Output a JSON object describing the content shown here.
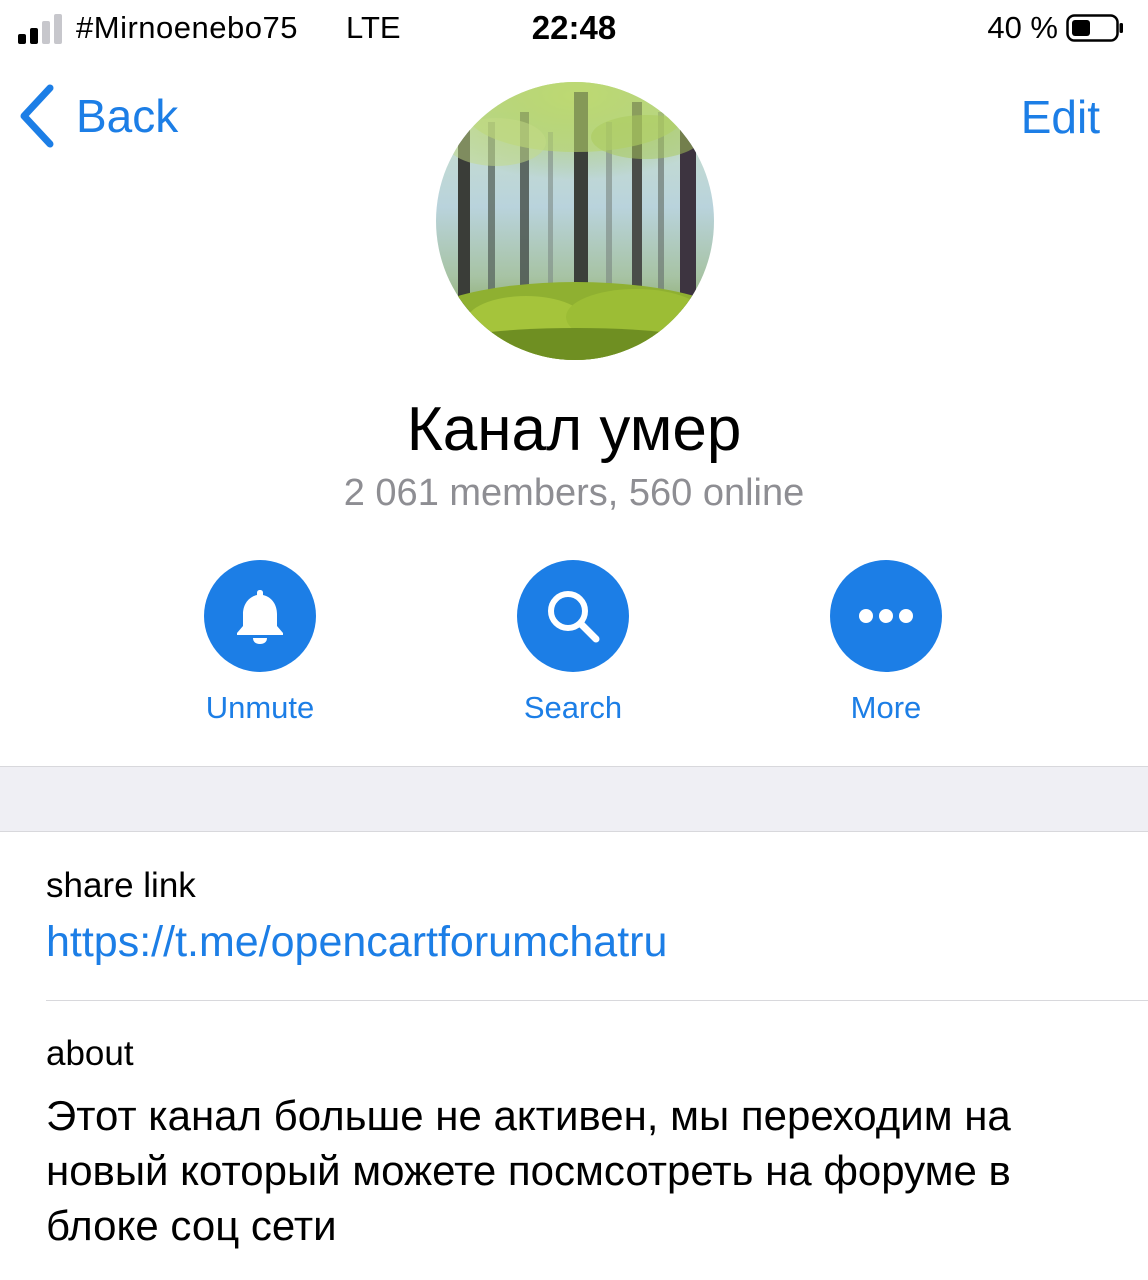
{
  "status_bar": {
    "carrier": "#Mirnoenebo75",
    "network": "LTE",
    "time": "22:48",
    "battery_percent": "40 %",
    "signal_bars_filled": 2,
    "signal_bars_total": 4,
    "battery_level": 0.4
  },
  "nav": {
    "back_label": "Back",
    "edit_label": "Edit"
  },
  "channel": {
    "title": "Канал умер",
    "subtitle": "2 061 members, 560 online"
  },
  "actions": [
    {
      "label": "Unmute",
      "icon": "bell-icon"
    },
    {
      "label": "Search",
      "icon": "search-icon"
    },
    {
      "label": "More",
      "icon": "more-icon"
    }
  ],
  "info": {
    "share_link_label": "share link",
    "share_link_url": "https://t.me/opencartforumchatru",
    "about_label": "about",
    "about_text": "Этот канал больше не активен, мы переходим на новый который можете посмсотреть на форуме в блоке соц сети"
  },
  "colors": {
    "accent": "#1c7ee6",
    "secondary_text": "#8e8e93",
    "band": "#efeff4"
  }
}
